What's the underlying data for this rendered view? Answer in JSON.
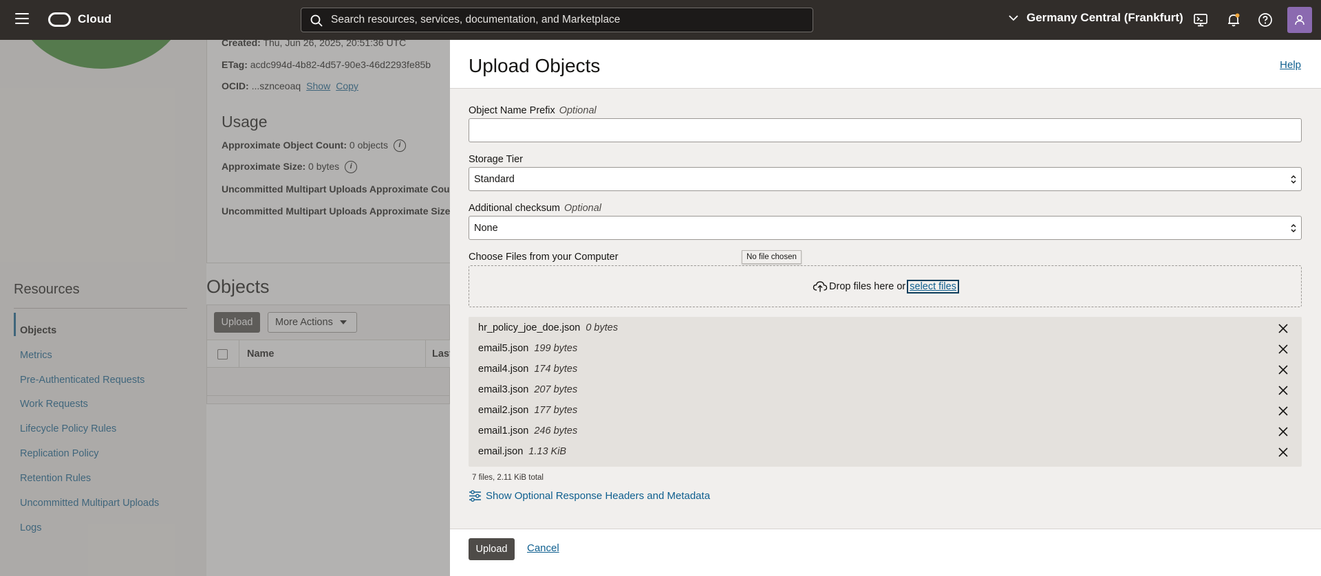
{
  "topbar": {
    "brand": "Cloud",
    "search_placeholder": "Search resources, services, documentation, and Marketplace",
    "region": "Germany Central (Frankfurt)"
  },
  "details": {
    "created_label": "Created:",
    "created_value": "Thu, Jun 26, 2025, 20:51:36 UTC",
    "etag_label": "ETag:",
    "etag_value": "acdc994d-4b82-4d57-90e3-46d2293fe85b",
    "ocid_label": "OCID:",
    "ocid_value": "...sznceoaq",
    "show": "Show",
    "copy": "Copy"
  },
  "usage": {
    "title": "Usage",
    "object_count_label": "Approximate Object Count:",
    "object_count_value": "0 objects",
    "size_label": "Approximate Size:",
    "size_value": "0 bytes",
    "multipart_count_label": "Uncommitted Multipart Uploads Approximate Cou",
    "multipart_size_label": "Uncommitted Multipart Uploads Approximate Size"
  },
  "resources": {
    "title": "Resources",
    "items": [
      {
        "label": "Objects"
      },
      {
        "label": "Metrics"
      },
      {
        "label": "Pre-Authenticated Requests"
      },
      {
        "label": "Work Requests"
      },
      {
        "label": "Lifecycle Policy Rules"
      },
      {
        "label": "Replication Policy"
      },
      {
        "label": "Retention Rules"
      },
      {
        "label": "Uncommitted Multipart Uploads"
      },
      {
        "label": "Logs"
      }
    ]
  },
  "objects": {
    "title": "Objects",
    "upload_label": "Upload",
    "more_actions_label": "More Actions",
    "columns": [
      "Name",
      "Last"
    ]
  },
  "upload_panel": {
    "title": "Upload Objects",
    "help": "Help",
    "prefix_label": "Object Name Prefix",
    "optional": "Optional",
    "prefix_value": "",
    "tier_label": "Storage Tier",
    "tier_value": "Standard",
    "checksum_label": "Additional checksum",
    "checksum_value": "None",
    "choose_label": "Choose Files from your Computer",
    "no_file_tooltip": "No file chosen",
    "drop_text": "Drop files here or",
    "select_files": "select files",
    "files": [
      {
        "name": "hr_policy_joe_doe.json",
        "size": "0 bytes"
      },
      {
        "name": "email5.json",
        "size": "199 bytes"
      },
      {
        "name": "email4.json",
        "size": "174 bytes"
      },
      {
        "name": "email3.json",
        "size": "207 bytes"
      },
      {
        "name": "email2.json",
        "size": "177 bytes"
      },
      {
        "name": "email1.json",
        "size": "246 bytes"
      },
      {
        "name": "email.json",
        "size": "1.13 KiB"
      }
    ],
    "total": "7 files, 2.11 KiB total",
    "show_optional": "Show Optional Response Headers and Metadata",
    "upload_button": "Upload",
    "cancel": "Cancel"
  }
}
